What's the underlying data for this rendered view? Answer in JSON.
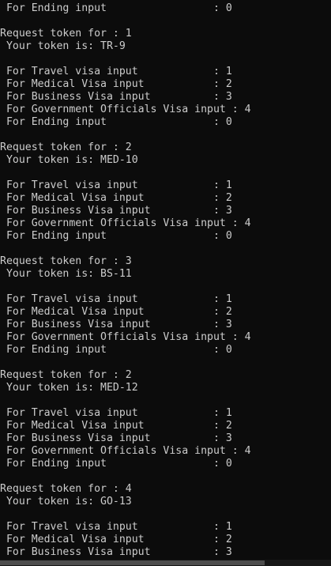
{
  "console": {
    "lines": [
      " For Ending input                 : 0",
      "",
      "Request token for : 1",
      " Your token is: TR-9",
      "",
      " For Travel visa input            : 1",
      " For Medical Visa input           : 2",
      " For Business Visa input          : 3",
      " For Government Officials Visa input : 4",
      " For Ending input                 : 0",
      "",
      "Request token for : 2",
      " Your token is: MED-10",
      "",
      " For Travel visa input            : 1",
      " For Medical Visa input           : 2",
      " For Business Visa input          : 3",
      " For Government Officials Visa input : 4",
      " For Ending input                 : 0",
      "",
      "Request token for : 3",
      " Your token is: BS-11",
      "",
      " For Travel visa input            : 1",
      " For Medical Visa input           : 2",
      " For Business Visa input          : 3",
      " For Government Officials Visa input : 4",
      " For Ending input                 : 0",
      "",
      "Request token for : 2",
      " Your token is: MED-12",
      "",
      " For Travel visa input            : 1",
      " For Medical Visa input           : 2",
      " For Business Visa input          : 3",
      " For Government Officials Visa input : 4",
      " For Ending input                 : 0",
      "",
      "Request token for : 4",
      " Your token is: GO-13",
      "",
      " For Travel visa input            : 1",
      " For Medical Visa input           : 2",
      " For Business Visa input          : 3"
    ]
  },
  "horizontal_scroll_position": 0
}
